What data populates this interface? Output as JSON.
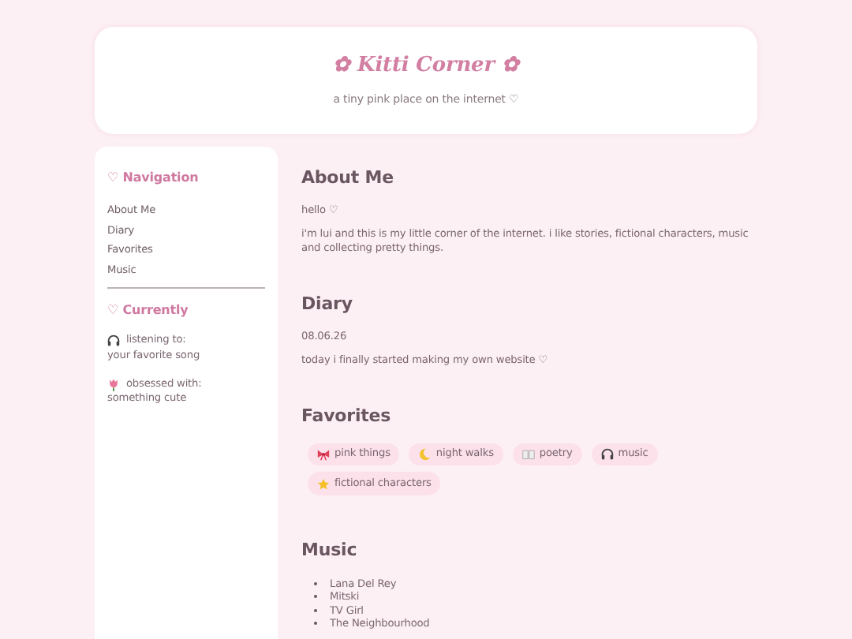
{
  "header": {
    "title": "✿ Kitti Corner ✿",
    "subtitle": "a tiny pink place on the internet ♡"
  },
  "sidebar": {
    "navigation": {
      "heading": "♡ Navigation",
      "items": [
        "About Me",
        "Diary",
        "Favorites",
        "Music"
      ]
    },
    "currently": {
      "heading": "♡ Currently",
      "items": [
        {
          "kind": "headphones",
          "label": "listening to:",
          "value": "your favorite song"
        },
        {
          "kind": "flower",
          "label": "obsessed with:",
          "value": "something cute"
        }
      ]
    }
  },
  "sections": [
    {
      "kind": "text",
      "title": "About Me",
      "paragraphs": [
        "hello ♡",
        "i'm lui and this is my little corner of the internet. i like stories, fictional characters, music and collecting pretty things."
      ]
    },
    {
      "kind": "text",
      "title": "Diary",
      "paragraphs": [
        "08.06.26",
        "today i finally started making my own website ♡"
      ]
    },
    {
      "kind": "tags",
      "title": "Favorites",
      "tags": [
        {
          "kind": "bow",
          "label": "pink things"
        },
        {
          "kind": "moon",
          "label": "night walks"
        },
        {
          "kind": "book",
          "label": "poetry"
        },
        {
          "kind": "headphones",
          "label": "music"
        },
        {
          "kind": "star",
          "label": "fictional characters"
        }
      ]
    },
    {
      "kind": "list",
      "title": "Music",
      "items": [
        "Lana Del Rey",
        "Mitski",
        "TV Girl",
        "The Neighbourhood"
      ]
    }
  ]
}
